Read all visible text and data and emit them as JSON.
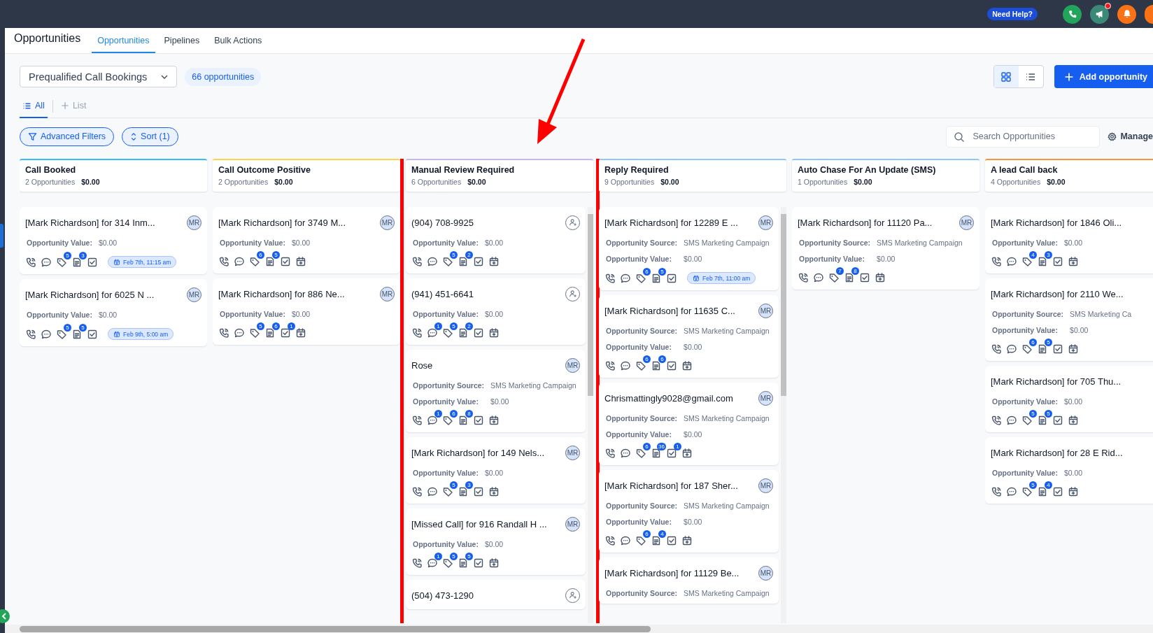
{
  "topbar": {
    "help_label": "Need Help?",
    "notification_dot": true
  },
  "header": {
    "title": "Opportunities",
    "tabs": [
      {
        "label": "Opportunities",
        "selected": true
      },
      {
        "label": "Pipelines",
        "selected": false
      },
      {
        "label": "Bulk Actions",
        "selected": false
      }
    ]
  },
  "toolbar": {
    "pipeline": "Prequalified Call Bookings",
    "count": "66 opportunities",
    "views": [
      {
        "kind": "grid",
        "selected": true
      },
      {
        "kind": "list",
        "selected": false
      }
    ],
    "add_label": "Add opportunity"
  },
  "view_tabs": [
    {
      "label": "All",
      "kind": "list",
      "selected": true
    },
    {
      "label": "List",
      "kind": "add",
      "selected": false
    }
  ],
  "filters": {
    "advanced": "Advanced Filters",
    "sort": "Sort (1)",
    "search_placeholder": "Search Opportunities",
    "manage": "Manage"
  },
  "columns": [
    {
      "title": "Call Booked",
      "count": "2 Opportunities",
      "value": "$0.00",
      "color": "#38bdf8",
      "highlighted": false,
      "scrollbar": false,
      "cards": [
        {
          "title": "[Mark Richardson] for 314 Inm...",
          "avatar": {
            "kind": "initials",
            "text": "MR"
          },
          "fields": [
            {
              "label": "Opportunity Value:",
              "value": "$0.00"
            }
          ],
          "actions": [
            {
              "kind": "call"
            },
            {
              "kind": "chat"
            },
            {
              "kind": "tag",
              "badge": "5"
            },
            {
              "kind": "note",
              "badge": "3"
            },
            {
              "kind": "task"
            },
            {
              "kind": "appointment",
              "label": "Feb 7th, 11:15 am"
            }
          ]
        },
        {
          "title": "[Mark Richardson] for 6025 N ...",
          "avatar": {
            "kind": "initials",
            "text": "MR"
          },
          "fields": [
            {
              "label": "Opportunity Value:",
              "value": "$0.00"
            }
          ],
          "actions": [
            {
              "kind": "call"
            },
            {
              "kind": "chat"
            },
            {
              "kind": "tag",
              "badge": "5"
            },
            {
              "kind": "note",
              "badge": "5"
            },
            {
              "kind": "task"
            },
            {
              "kind": "appointment",
              "label": "Feb 9th, 5:00 am"
            }
          ]
        }
      ]
    },
    {
      "title": "Call Outcome Positive",
      "count": "2 Opportunities",
      "value": "$0.00",
      "color": "#fcd34d",
      "highlighted": false,
      "scrollbar": false,
      "cards": [
        {
          "title": "[Mark Richardson] for 3749 M...",
          "avatar": {
            "kind": "initials",
            "text": "MR"
          },
          "fields": [
            {
              "label": "Opportunity Value:",
              "value": "$0.00"
            }
          ],
          "actions": [
            {
              "kind": "call"
            },
            {
              "kind": "chat"
            },
            {
              "kind": "tag",
              "badge": "6"
            },
            {
              "kind": "note",
              "badge": "5"
            },
            {
              "kind": "task"
            },
            {
              "kind": "calendar"
            }
          ]
        },
        {
          "title": "[Mark Richardson] for 886 Ne...",
          "avatar": {
            "kind": "initials",
            "text": "MR"
          },
          "fields": [
            {
              "label": "Opportunity Value:",
              "value": "$0.00"
            }
          ],
          "actions": [
            {
              "kind": "call"
            },
            {
              "kind": "chat"
            },
            {
              "kind": "tag",
              "badge": "5"
            },
            {
              "kind": "note",
              "badge": "6"
            },
            {
              "kind": "task",
              "badge": "1"
            },
            {
              "kind": "calendar"
            }
          ]
        }
      ]
    },
    {
      "title": "Manual Review Required",
      "count": "6 Opportunities",
      "value": "$0.00",
      "color": "#c4b5fd",
      "highlighted": true,
      "scrollbar": true,
      "cards": [
        {
          "title": "(904) 708-9925",
          "avatar": {
            "kind": "add-user"
          },
          "fields": [
            {
              "label": "Opportunity Value:",
              "value": "$0.00"
            }
          ],
          "actions": [
            {
              "kind": "call"
            },
            {
              "kind": "chat"
            },
            {
              "kind": "tag",
              "badge": "5"
            },
            {
              "kind": "note",
              "badge": "2"
            },
            {
              "kind": "task"
            },
            {
              "kind": "calendar"
            }
          ]
        },
        {
          "title": "(941) 451-6641",
          "avatar": {
            "kind": "add-user"
          },
          "fields": [
            {
              "label": "Opportunity Value:",
              "value": "$0.00"
            }
          ],
          "actions": [
            {
              "kind": "call"
            },
            {
              "kind": "chat",
              "badge": "1"
            },
            {
              "kind": "tag",
              "badge": "5"
            },
            {
              "kind": "note",
              "badge": "2"
            },
            {
              "kind": "task"
            },
            {
              "kind": "calendar"
            }
          ]
        },
        {
          "title": "Rose",
          "avatar": {
            "kind": "initials",
            "text": "MR"
          },
          "fields": [
            {
              "label": "Opportunity Source:",
              "value": "SMS Marketing Campaign"
            },
            {
              "label": "Opportunity Value:",
              "value": "$0.00"
            }
          ],
          "actions": [
            {
              "kind": "call"
            },
            {
              "kind": "chat",
              "badge": "1"
            },
            {
              "kind": "tag",
              "badge": "6"
            },
            {
              "kind": "note",
              "badge": "8"
            },
            {
              "kind": "task"
            },
            {
              "kind": "calendar"
            }
          ]
        },
        {
          "title": "[Mark Richardson] for 149 Nels...",
          "avatar": {
            "kind": "initials",
            "text": "MR"
          },
          "fields": [
            {
              "label": "Opportunity Value:",
              "value": "$0.00"
            }
          ],
          "actions": [
            {
              "kind": "call"
            },
            {
              "kind": "chat"
            },
            {
              "kind": "tag",
              "badge": "5"
            },
            {
              "kind": "note",
              "badge": "3"
            },
            {
              "kind": "task"
            },
            {
              "kind": "calendar"
            }
          ]
        },
        {
          "title": "[Missed Call] for 916 Randall H ...",
          "avatar": {
            "kind": "initials",
            "text": "MR"
          },
          "fields": [
            {
              "label": "Opportunity Value:",
              "value": "$0.00"
            }
          ],
          "actions": [
            {
              "kind": "call"
            },
            {
              "kind": "chat",
              "badge": "1"
            },
            {
              "kind": "tag",
              "badge": "5"
            },
            {
              "kind": "note",
              "badge": "5"
            },
            {
              "kind": "task"
            },
            {
              "kind": "calendar"
            }
          ]
        },
        {
          "title": "(504) 473-1290",
          "avatar": {
            "kind": "add-user"
          }
        }
      ]
    },
    {
      "title": "Reply Required",
      "count": "9 Opportunities",
      "value": "$0.00",
      "color": "#93c5fd",
      "highlighted": false,
      "scrollbar": true,
      "cards": [
        {
          "title": "[Mark Richardson] for 12289 E ...",
          "avatar": {
            "kind": "initials",
            "text": "MR"
          },
          "fields": [
            {
              "label": "Opportunity Source:",
              "value": "SMS Marketing Campaign"
            },
            {
              "label": "Opportunity Value:",
              "value": "$0.00"
            }
          ],
          "actions": [
            {
              "kind": "call"
            },
            {
              "kind": "chat"
            },
            {
              "kind": "tag",
              "badge": "6"
            },
            {
              "kind": "note",
              "badge": "5"
            },
            {
              "kind": "task"
            },
            {
              "kind": "appointment",
              "label": "Feb 7th, 11:00 am"
            }
          ]
        },
        {
          "title": "[Mark Richardson] for 11635 C...",
          "avatar": {
            "kind": "initials",
            "text": "MR"
          },
          "fields": [
            {
              "label": "Opportunity Source:",
              "value": "SMS Marketing Campaign"
            },
            {
              "label": "Opportunity Value:",
              "value": "$0.00"
            }
          ],
          "actions": [
            {
              "kind": "call"
            },
            {
              "kind": "chat"
            },
            {
              "kind": "tag",
              "badge": "6"
            },
            {
              "kind": "note",
              "badge": "6"
            },
            {
              "kind": "task"
            },
            {
              "kind": "calendar"
            }
          ]
        },
        {
          "title": "Chrismattingly9028@gmail.com",
          "avatar": {
            "kind": "initials",
            "text": "MR"
          },
          "fields": [
            {
              "label": "Opportunity Source:",
              "value": "SMS Marketing Campaign"
            },
            {
              "label": "Opportunity Value:",
              "value": "$0.00"
            }
          ],
          "actions": [
            {
              "kind": "call"
            },
            {
              "kind": "chat"
            },
            {
              "kind": "tag",
              "badge": "6"
            },
            {
              "kind": "note",
              "badge": "36"
            },
            {
              "kind": "task",
              "badge": "1"
            },
            {
              "kind": "calendar"
            }
          ]
        },
        {
          "title": "[Mark Richardson] for 187 Sher...",
          "avatar": {
            "kind": "initials",
            "text": "MR"
          },
          "fields": [
            {
              "label": "Opportunity Source:",
              "value": "SMS Marketing Campaign"
            },
            {
              "label": "Opportunity Value:",
              "value": "$0.00"
            }
          ],
          "actions": [
            {
              "kind": "call"
            },
            {
              "kind": "chat"
            },
            {
              "kind": "tag",
              "badge": "6"
            },
            {
              "kind": "note",
              "badge": "4"
            },
            {
              "kind": "task"
            },
            {
              "kind": "calendar"
            }
          ]
        },
        {
          "title": "[Mark Richardson] for 11129 Be...",
          "avatar": {
            "kind": "initials",
            "text": "MR"
          },
          "fields": [
            {
              "label": "Opportunity Source:",
              "value": "SMS Marketing Campaign"
            }
          ]
        }
      ]
    },
    {
      "title": "Auto Chase For An Update (SMS)",
      "count": "1 Opportunities",
      "value": "$0.00",
      "color": "#93c5fd",
      "highlighted": false,
      "scrollbar": false,
      "cards": [
        {
          "title": "[Mark Richardson] for 11120 Pa...",
          "avatar": {
            "kind": "initials",
            "text": "MR"
          },
          "fields": [
            {
              "label": "Opportunity Source:",
              "value": "SMS Marketing Campaign"
            },
            {
              "label": "Opportunity Value:",
              "value": "$0.00"
            }
          ],
          "actions": [
            {
              "kind": "call"
            },
            {
              "kind": "chat"
            },
            {
              "kind": "tag",
              "badge": "7"
            },
            {
              "kind": "note",
              "badge": "8"
            },
            {
              "kind": "task"
            },
            {
              "kind": "calendar"
            }
          ]
        }
      ]
    },
    {
      "title": "A lead Call back",
      "count": "4 Opportunities",
      "value": "$0.00",
      "color": "#fb923c",
      "highlighted": false,
      "scrollbar": false,
      "cards": [
        {
          "title": "[Mark Richardson] for 1846 Oli...",
          "fields": [
            {
              "label": "Opportunity Value:",
              "value": "$0.00"
            }
          ],
          "actions": [
            {
              "kind": "call"
            },
            {
              "kind": "chat"
            },
            {
              "kind": "tag",
              "badge": "4"
            },
            {
              "kind": "note",
              "badge": "3"
            },
            {
              "kind": "task"
            },
            {
              "kind": "calendar"
            }
          ]
        },
        {
          "title": "[Mark Richardson] for 2110 We...",
          "fields": [
            {
              "label": "Opportunity Source:",
              "value": "SMS Marketing Ca"
            },
            {
              "label": "Opportunity Value:",
              "value": "$0.00"
            }
          ],
          "actions": [
            {
              "kind": "call"
            },
            {
              "kind": "chat"
            },
            {
              "kind": "tag",
              "badge": "6"
            },
            {
              "kind": "note",
              "badge": "5"
            },
            {
              "kind": "task"
            },
            {
              "kind": "calendar"
            }
          ]
        },
        {
          "title": "[Mark Richardson] for 705 Thu...",
          "fields": [
            {
              "label": "Opportunity Value:",
              "value": "$0.00"
            }
          ],
          "actions": [
            {
              "kind": "call"
            },
            {
              "kind": "chat"
            },
            {
              "kind": "tag",
              "badge": "5"
            },
            {
              "kind": "note",
              "badge": "5"
            },
            {
              "kind": "task"
            },
            {
              "kind": "calendar"
            }
          ]
        },
        {
          "title": "[Mark Richardson] for 28 E Rid...",
          "fields": [
            {
              "label": "Opportunity Value:",
              "value": "$0.00"
            }
          ],
          "actions": [
            {
              "kind": "call"
            },
            {
              "kind": "chat"
            },
            {
              "kind": "tag",
              "badge": "5"
            },
            {
              "kind": "note",
              "badge": "4"
            },
            {
              "kind": "task"
            },
            {
              "kind": "calendar"
            }
          ]
        }
      ]
    }
  ]
}
